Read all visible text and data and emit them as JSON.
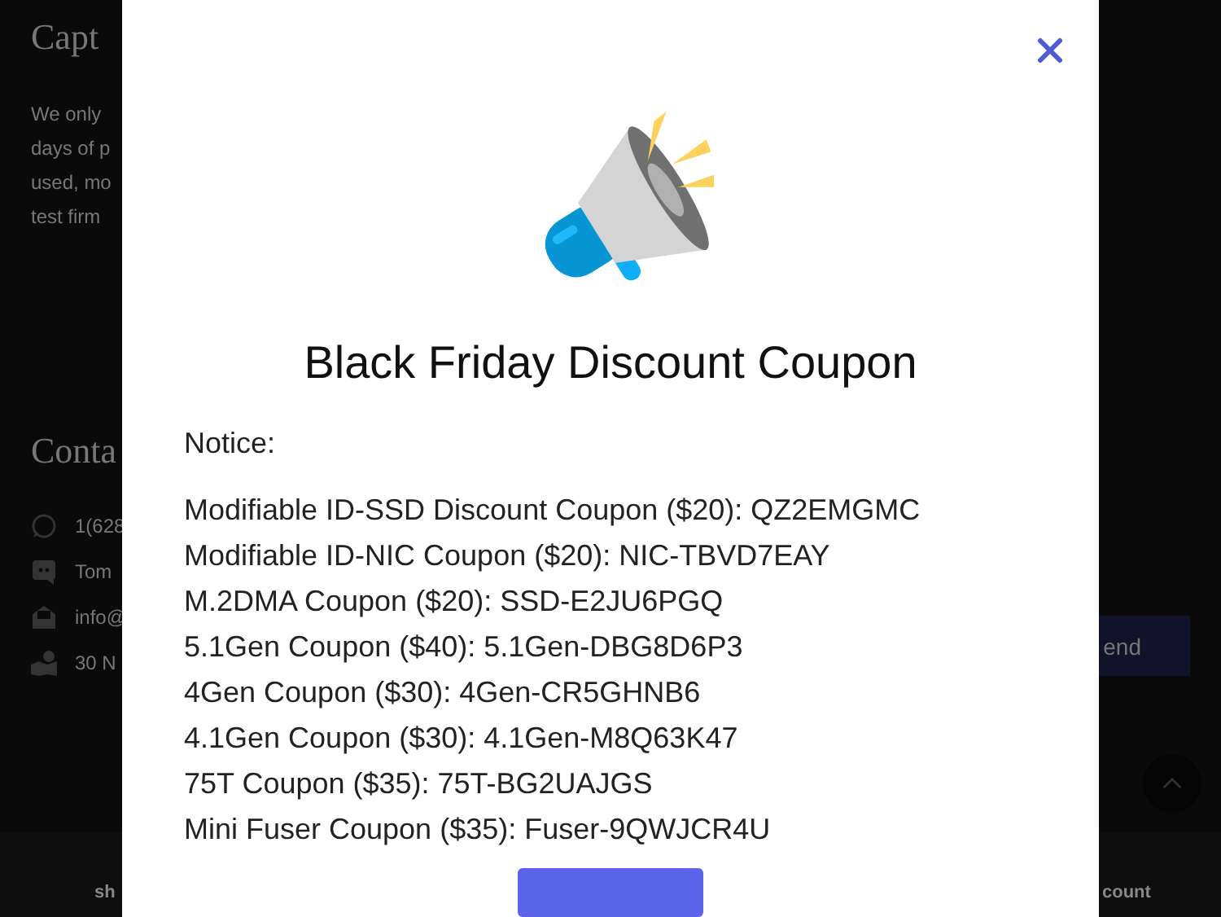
{
  "page": {
    "heading": "Capt",
    "paragraph_lines": [
      "We only",
      "days of p",
      "used, mo",
      "test firm"
    ],
    "contact_heading": "Conta",
    "contacts": [
      {
        "kind": "whatsapp",
        "text": "1(628"
      },
      {
        "kind": "discord",
        "text": "Tom"
      },
      {
        "kind": "email",
        "text": "info@"
      },
      {
        "kind": "map",
        "text": "30 N"
      }
    ],
    "send_button": "end",
    "nav_left": "sh",
    "nav_right": "count"
  },
  "modal": {
    "title": "Black Friday Discount Coupon",
    "notice": "Notice:",
    "coupons": [
      "Modifiable ID-SSD Discount Coupon ($20): QZ2EMGMC",
      "Modifiable ID-NIC Coupon ($20): NIC-TBVD7EAY",
      "M.2DMA Coupon ($20): SSD-E2JU6PGQ",
      "5.1Gen Coupon ($40): 5.1Gen-DBG8D6P3",
      "4Gen Coupon ($30): 4Gen-CR5GHNB6",
      "4.1Gen Coupon ($30): 4.1Gen-M8Q63K47",
      "75T Coupon ($35): 75T-BG2UAJGS",
      "Mini Fuser Coupon ($35): Fuser-9QWJCR4U"
    ]
  }
}
